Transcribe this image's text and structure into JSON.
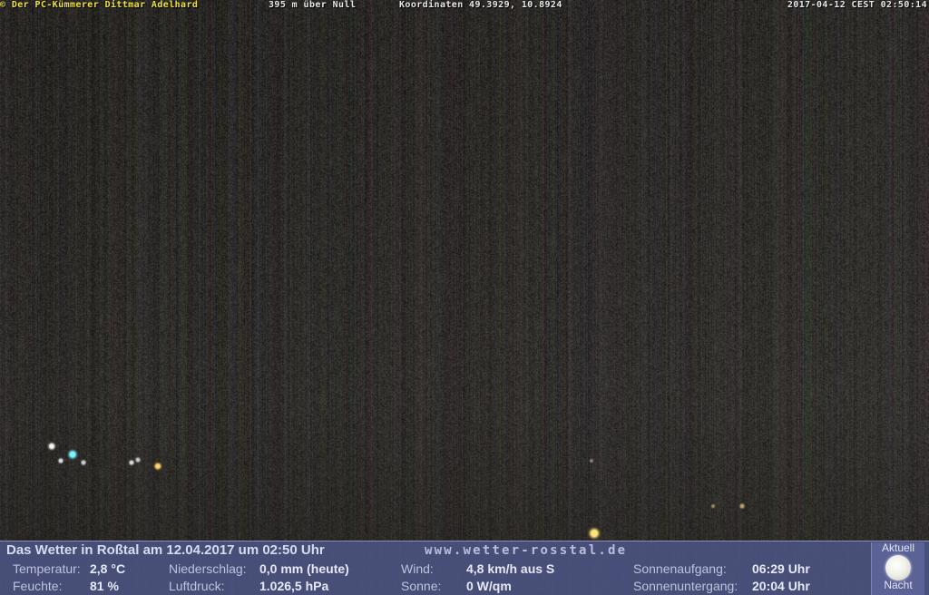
{
  "camera_overlay": {
    "copyright": "© Der PC-Kümmerer Dittmar Adelhard",
    "altitude": "395 m über Null",
    "coordinates": "Koordinaten 49.3929, 10.8924",
    "timestamp": "2017-04-12 CEST 02:50:14"
  },
  "weather": {
    "headline": "Das Wetter in Roßtal am 12.04.2017 um 02:50 Uhr",
    "website": "www.wetter-rosstal.de",
    "temperature": {
      "label": "Temperatur:",
      "value": "2,8 °C"
    },
    "humidity": {
      "label": "Feuchte:",
      "value": "81 %"
    },
    "precipitation": {
      "label": "Niederschlag:",
      "value": "0,0 mm (heute)"
    },
    "pressure": {
      "label": "Luftdruck:",
      "value": "1.026,5 hPa"
    },
    "wind": {
      "label": "Wind:",
      "value": "4,8 km/h aus S"
    },
    "sun": {
      "label": "Sonne:",
      "value": "0 W/qm"
    },
    "sunrise": {
      "label": "Sonnenaufgang:",
      "value": "06:29 Uhr"
    },
    "sunset": {
      "label": "Sonnenuntergang:",
      "value": "20:04 Uhr"
    }
  },
  "moon": {
    "status_label": "Aktuell",
    "phase_label": "Nacht",
    "icon": "full-moon-icon"
  },
  "colors": {
    "overlay_copyright": "#f0e23c",
    "overlay_text": "#e8e8e8",
    "panel_background": "#4a5280",
    "scene_background": "#2b2a28"
  }
}
